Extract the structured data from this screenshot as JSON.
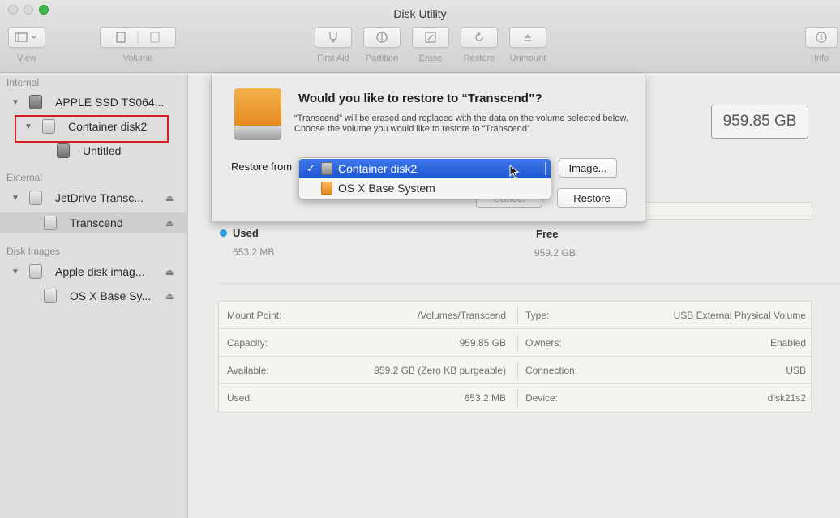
{
  "window": {
    "title": "Disk Utility"
  },
  "toolbar": {
    "view_label": "View",
    "volume_label": "Volume",
    "first_aid_label": "First Aid",
    "partition_label": "Partition",
    "erase_label": "Erase",
    "restore_label": "Restore",
    "unmount_label": "Unmount",
    "info_label": "Info"
  },
  "sidebar": {
    "sections": {
      "internal": "Internal",
      "external": "External",
      "disk_images": "Disk Images"
    },
    "items": [
      {
        "label": "APPLE SSD TS064..."
      },
      {
        "label": "Container disk2"
      },
      {
        "label": "Untitled"
      },
      {
        "label": "JetDrive Transc..."
      },
      {
        "label": "Transcend"
      },
      {
        "label": "Apple disk imag..."
      },
      {
        "label": "OS X Base Sy..."
      }
    ]
  },
  "main": {
    "capacity": "959.85 GB",
    "usage": {
      "used_title": "Used",
      "used_value": "653.2 MB",
      "free_title": "Free",
      "free_value": "959.2 GB",
      "used_color": "#2e9ae2"
    },
    "info": {
      "left": [
        {
          "key": "Mount Point:",
          "value": "/Volumes/Transcend"
        },
        {
          "key": "Capacity:",
          "value": "959.85 GB"
        },
        {
          "key": "Available:",
          "value": "959.2 GB (Zero KB purgeable)"
        },
        {
          "key": "Used:",
          "value": "653.2 MB"
        }
      ],
      "right": [
        {
          "key": "Type:",
          "value": "USB External Physical Volume"
        },
        {
          "key": "Owners:",
          "value": "Enabled"
        },
        {
          "key": "Connection:",
          "value": "USB"
        },
        {
          "key": "Device:",
          "value": "disk21s2"
        }
      ]
    }
  },
  "sheet": {
    "title": "Would you like to restore to “Transcend”?",
    "message": "“Transcend” will be erased and replaced with the data on the volume selected below. Choose the volume you would like to restore to “Transcend”.",
    "restore_from_label": "Restore from",
    "image_button": "Image...",
    "cancel_button": "Cancel",
    "restore_button": "Restore",
    "dropdown_options": [
      {
        "label": "Container disk2",
        "selected": true
      },
      {
        "label": "OS X Base System",
        "selected": false
      }
    ],
    "checkmark": "✓"
  },
  "colors": {
    "highlight_box": "#d91f26",
    "selection_blue": "#1f56d4",
    "drive_orange": "#e68a1f"
  }
}
